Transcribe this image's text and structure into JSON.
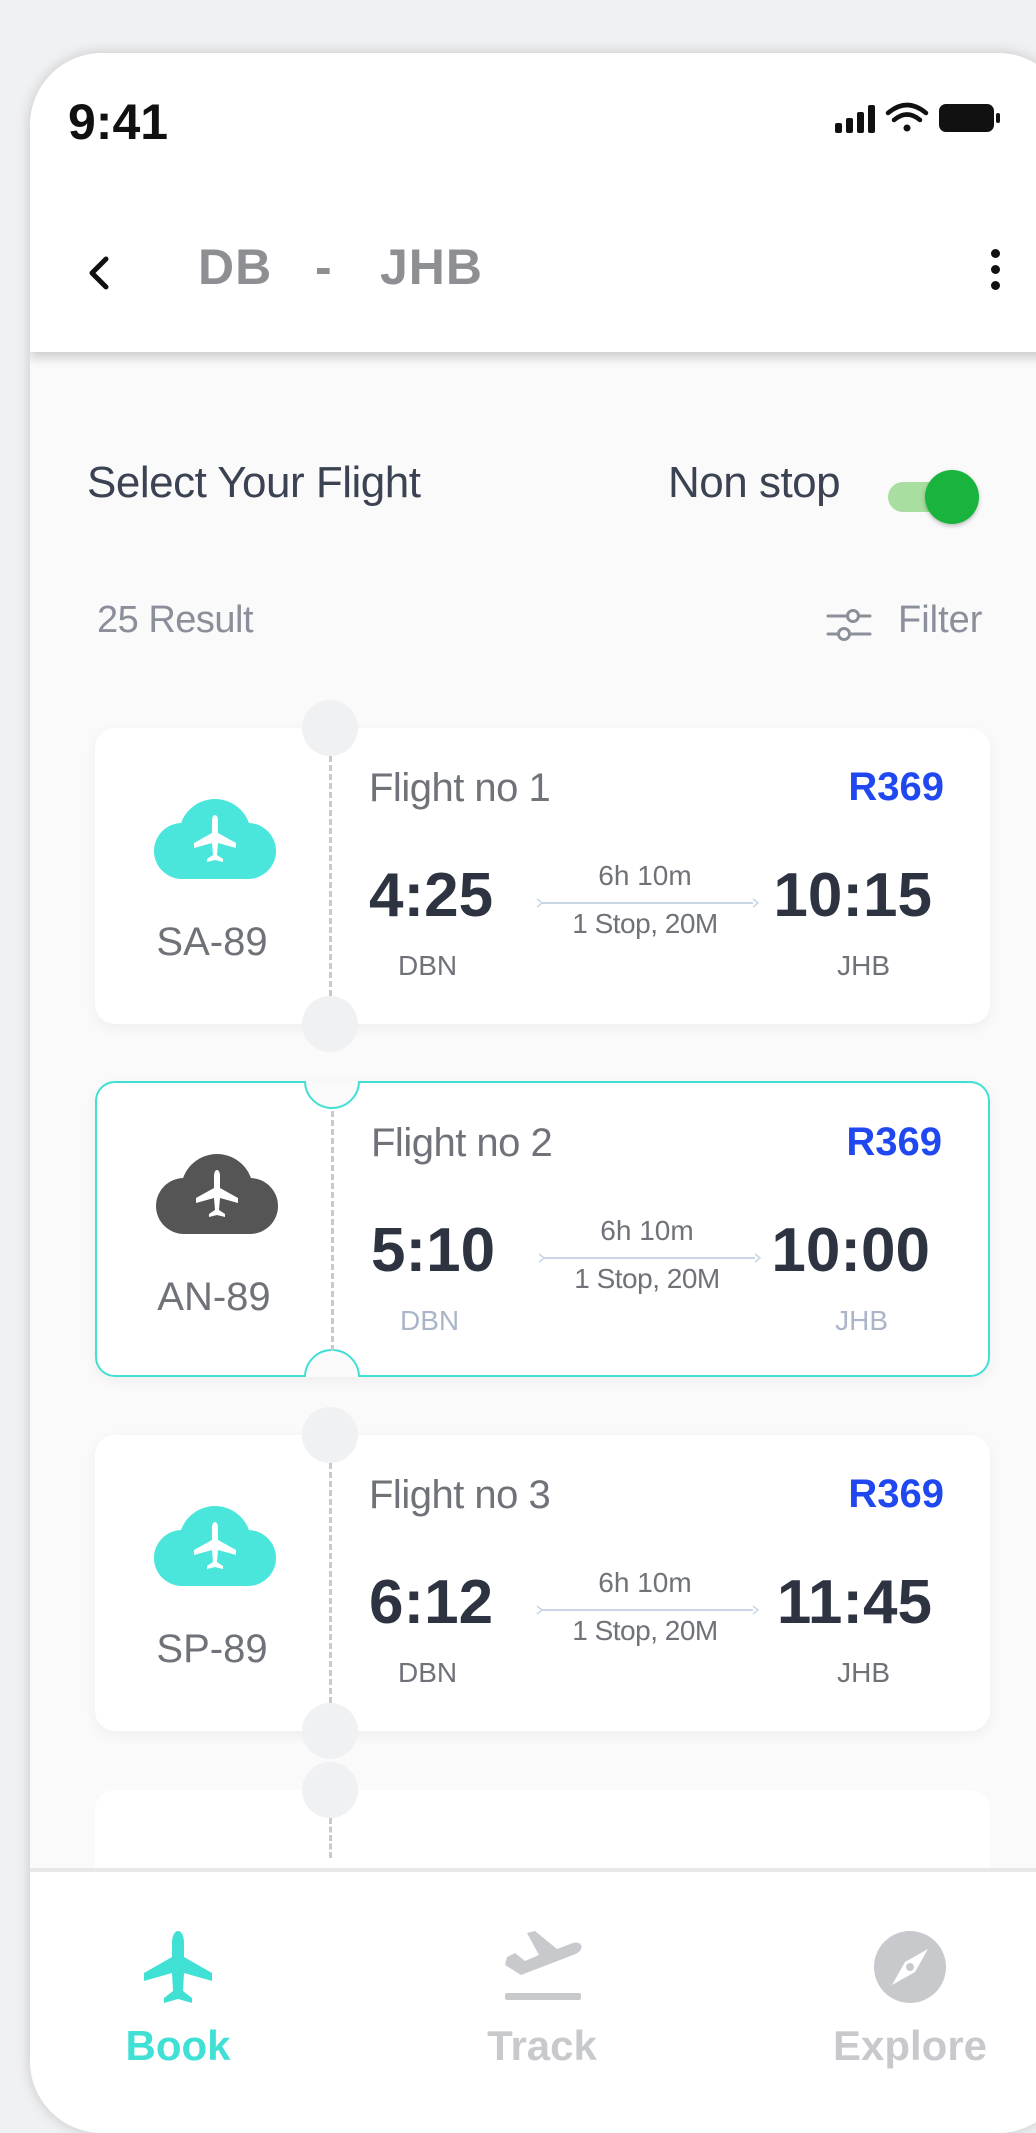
{
  "status_bar": {
    "time": "9:41"
  },
  "header": {
    "origin": "DB",
    "separator": "-",
    "destination": "JHB"
  },
  "section": {
    "title": "Select Your Flight",
    "nonstop_label": "Non stop",
    "nonstop_enabled": true
  },
  "results": {
    "count_label": "25 Result",
    "filter_label": "Filter"
  },
  "colors": {
    "accent": "#40e0d5",
    "price": "#1f48f0",
    "toggle_on": "#19b43d",
    "tab_active": "#40e0d5",
    "tab_inactive": "#c7c9cd"
  },
  "flights": [
    {
      "airline_code": "SA-89",
      "name": "Flight no 1",
      "price": "R369",
      "departure_time": "4:25",
      "departure_code": "DBN",
      "arrival_time": "10:15",
      "arrival_code": "JHB",
      "duration": "6h 10m",
      "stops": "1 Stop, 20M",
      "logo_color": "#4ae6dc"
    },
    {
      "airline_code": "AN-89",
      "name": "Flight no 2",
      "price": "R369",
      "departure_time": "5:10",
      "departure_code": "DBN",
      "arrival_time": "10:00",
      "arrival_code": "JHB",
      "duration": "6h 10m",
      "stops": "1 Stop, 20M",
      "logo_color": "#555555",
      "selected": true
    },
    {
      "airline_code": "SP-89",
      "name": "Flight no 3",
      "price": "R369",
      "departure_time": "6:12",
      "departure_code": "DBN",
      "arrival_time": "11:45",
      "arrival_code": "JHB",
      "duration": "6h 10m",
      "stops": "1 Stop, 20M",
      "logo_color": "#4ae6dc"
    }
  ],
  "tabs": [
    {
      "label": "Book",
      "icon": "plane-icon",
      "active": true
    },
    {
      "label": "Track",
      "icon": "departure-icon",
      "active": false
    },
    {
      "label": "Explore",
      "icon": "compass-icon",
      "active": false
    }
  ]
}
